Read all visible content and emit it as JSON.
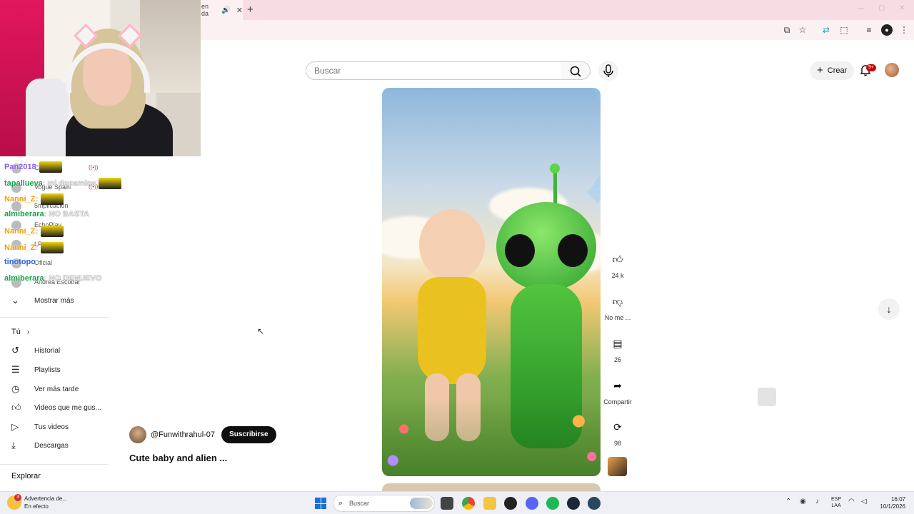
{
  "browser": {
    "tab_title": "en da",
    "tab_audio_icon": "speaker-icon",
    "tab_close_icon": "close-icon",
    "new_tab_icon": "plus-icon"
  },
  "youtube": {
    "search_placeholder": "Buscar",
    "create_label": "Crear",
    "notifications_badge": "9+"
  },
  "chat": [
    {
      "user": "Pan2018",
      "user_color": "#8b5cf6",
      "msg": "",
      "emote": true
    },
    {
      "user": "tapallueva",
      "user_color": "#16a34a",
      "msg": ": mi dopamina",
      "emote": true
    },
    {
      "user": "Nanni_Z",
      "user_color": "#f59e0b",
      "msg": ":",
      "emote": true
    },
    {
      "user": "almiberara",
      "user_color": "#16a34a",
      "msg": ": NO BASTA",
      "emote": false
    },
    {
      "user": "Nanni_Z",
      "user_color": "#f59e0b",
      "msg": ":",
      "emote": true
    },
    {
      "user": "Nanni_Z",
      "user_color": "#f59e0b",
      "msg": ":",
      "emote": true
    },
    {
      "user": "tinotopo",
      "user_color": "#2563eb",
      "msg": "",
      "emote": false
    },
    {
      "user": "almiberara",
      "user_color": "#16a34a",
      "msg": ": NO DENUEVO",
      "emote": false
    }
  ],
  "subscriptions": [
    {
      "name": "CZN",
      "live": true
    },
    {
      "name": "Vogue Spain",
      "live": true
    },
    {
      "name": "5mplicación",
      "live": false
    },
    {
      "name": "EchoPlay",
      "live": false
    },
    {
      "name": "LP",
      "live": false
    },
    {
      "name": "Oficial",
      "live": false
    },
    {
      "name": "Andrea Escobar",
      "live": false
    }
  ],
  "sidebar": {
    "show_more": "Mostrar más",
    "you_section": "Tú",
    "you_items": [
      {
        "label": "Historial",
        "icon": "history-icon"
      },
      {
        "label": "Playlists",
        "icon": "playlist-icon"
      },
      {
        "label": "Ver más tarde",
        "icon": "clock-icon"
      },
      {
        "label": "Videos que me gus...",
        "icon": "thumb-up-icon"
      },
      {
        "label": "Tus videos",
        "icon": "play-icon"
      },
      {
        "label": "Descargas",
        "icon": "download-icon"
      }
    ],
    "explore_section": "Explorar"
  },
  "short": {
    "channel_handle": "@Funwithrahul-07",
    "subscribe_label": "Suscribirse",
    "title": "Cute baby and alien ...",
    "likes": "24 k",
    "dislike_label": "No me ...",
    "comments": "26",
    "share_label": "Compartir",
    "remix_count": "98"
  },
  "taskbar": {
    "weather_line1": "Advertencia de...",
    "weather_line2": "En efecto",
    "weather_badge": "3",
    "search_placeholder": "Buscar",
    "lang_line1": "ESP",
    "lang_line2": "LAA",
    "time": "16:07",
    "date": "10/1/2026"
  }
}
